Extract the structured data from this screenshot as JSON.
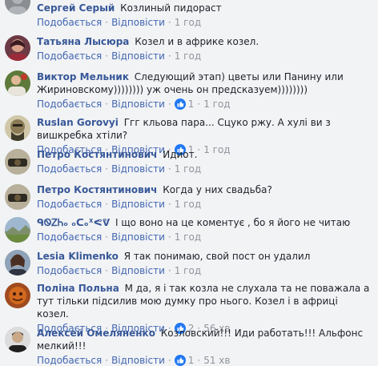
{
  "actions": {
    "like_label": "Подобається",
    "reply_label": "Відповісти",
    "separator": "·"
  },
  "comments": [
    {
      "author": "Сергей Серый",
      "text": "Козлиный пидораст",
      "time": "1 год",
      "reactions": null
    },
    {
      "author": "Татьяна Лысюра",
      "text": "Козел и в африке козел.",
      "time": "1 год",
      "reactions": null
    },
    {
      "author": "Виктор Мельник",
      "text": "Следующий этап) цветы или Панину или Жириновскому)))))))) уж очень он предсказуем))))))))",
      "time": "1 год",
      "reactions": "1"
    },
    {
      "author": "Ruslan Gorovyi",
      "text": "Ггг кльова пара... Сцуко ржу. А хулі ви з вишкребка хтіли?",
      "time": "1 год",
      "reactions": "1"
    },
    {
      "author": "Петро Костянтинович",
      "text": "Идиот.",
      "time": "1 год",
      "reactions": null
    },
    {
      "author": "Петро Костянтинович",
      "text": "Когда у них свадьба?",
      "time": "1 год",
      "reactions": null
    },
    {
      "author": "ᑫᏫᏃᏂₒ ₒᑕₒᕁᕙᕓ",
      "text": "І що воно на це коментує , бо я його не читаю",
      "time": "1 год",
      "reactions": null
    },
    {
      "author": "Lesia Klimenko",
      "text": "Я так понимаю, свой пост он удалил",
      "time": "1 год",
      "reactions": null
    },
    {
      "author": "Поліна Польна",
      "text": "М да, я і так козла не слухала та не поважала а тут тільки підсилив мою думку про нього. Козел і в африці козел.",
      "time": "56 хв",
      "reactions": "2"
    },
    {
      "author": "Алексей Омеляненко",
      "text": "Козловский!!! Иди работать!!! Альфонс мелкий!!!",
      "time": "51 хв",
      "reactions": "1"
    }
  ],
  "colors": {
    "background": "#f2f3f5",
    "author": "#385898",
    "link": "#4267b2",
    "meta": "#90949c",
    "like_reaction": "#2078f4"
  },
  "icons": {
    "like_reaction": "thumbs-up-icon"
  }
}
